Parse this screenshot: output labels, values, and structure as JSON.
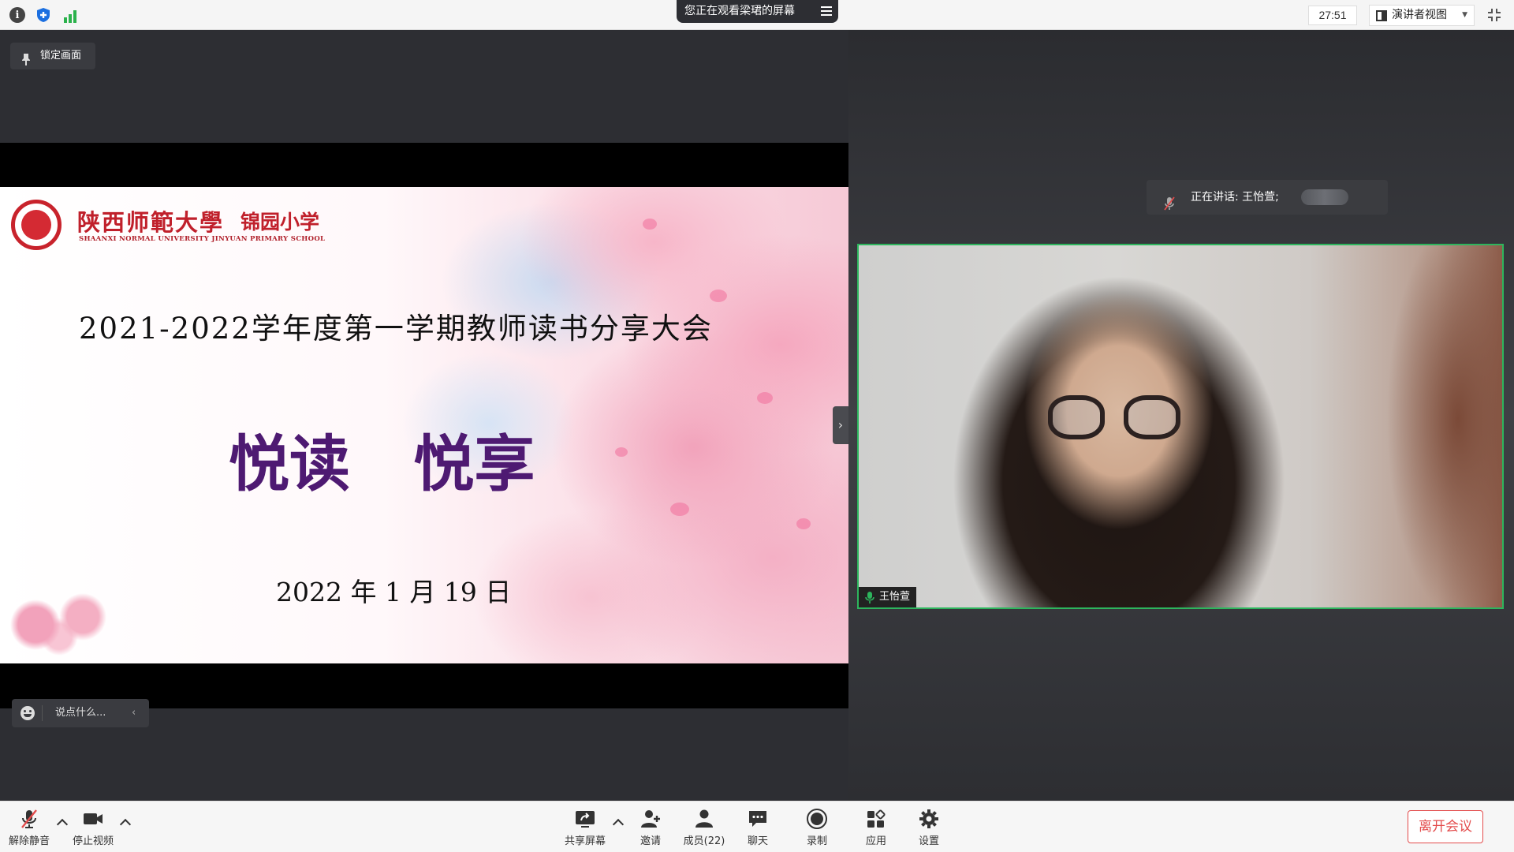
{
  "topbar": {
    "viewing_label": "您正在观看梁珺的屏幕",
    "timer": "27:51",
    "view_mode": "演讲者视图"
  },
  "share": {
    "lock_label": "锁定画面",
    "comment_placeholder": "说点什么...",
    "slide": {
      "logo_cn": "陕西师範大學",
      "logo_school": "锦园小学",
      "logo_en": "SHAANXI NORMAL UNIVERSITY JINYUAN PRIMARY SCHOOL",
      "title": "2021-2022学年度第一学期教师读书分享大会",
      "main": "悦读   悦享",
      "date": "2022 年 1 月 19 日"
    }
  },
  "gallery": {
    "speaking": "正在讲话: 王怡萱;",
    "participant_name": "王怡萱"
  },
  "toolbar": {
    "unmute": "解除静音",
    "stop_video": "停止视频",
    "share_screen": "共享屏幕",
    "invite": "邀请",
    "members": "成员(22)",
    "chat": "聊天",
    "record": "录制",
    "apps": "应用",
    "settings": "设置",
    "leave": "离开会议"
  },
  "colors": {
    "accent_green": "#2db55d",
    "leave_red": "#e34c4c",
    "slide_purple": "#4e1a72",
    "logo_red": "#c0202b"
  }
}
